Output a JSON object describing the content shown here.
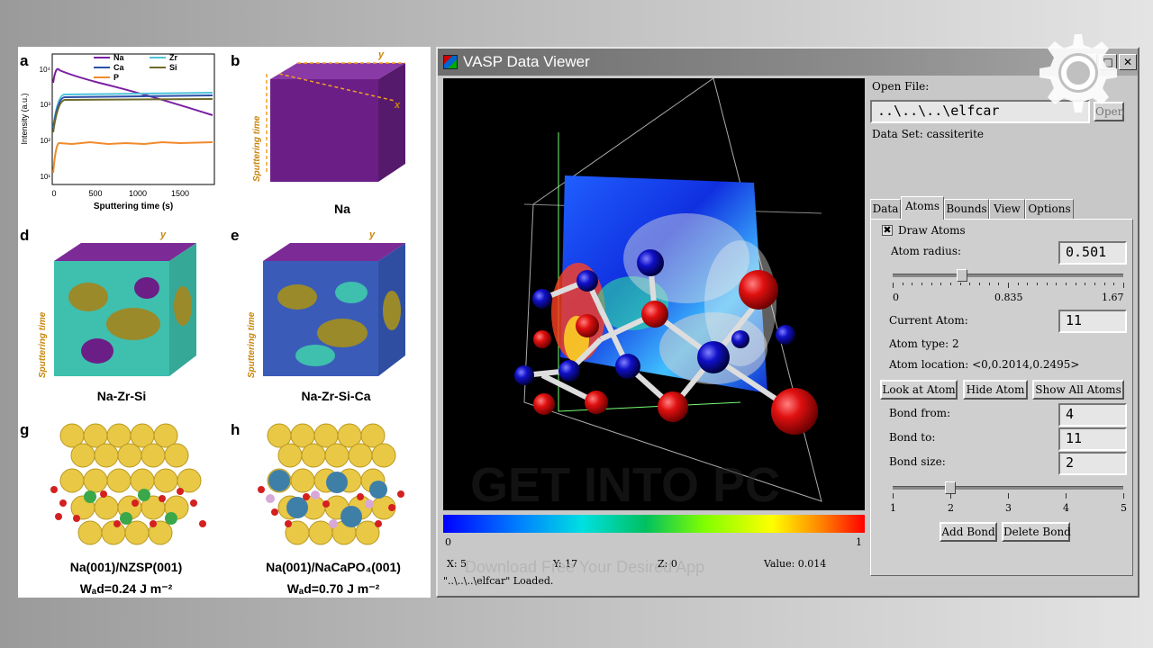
{
  "figure": {
    "panel_labels": [
      "a",
      "b",
      "d",
      "e",
      "g",
      "h"
    ],
    "chart_a": {
      "legend": [
        "Na",
        "Zr",
        "Ca",
        "Si",
        "P"
      ],
      "ylabel": "Intensity (a.u.)",
      "xlabel": "Sputtering time (s)",
      "yticks": [
        "10⁴",
        "10³",
        "10²",
        "10¹"
      ],
      "xticks": [
        "0",
        "500",
        "1000",
        "1500"
      ],
      "colors": {
        "Na": "#7a1fa2",
        "Zr": "#4fc3d9",
        "Ca": "#2c4fa8",
        "Si": "#6e6a2a",
        "P": "#f08a2c"
      }
    },
    "axis_y": "y",
    "axis_x": "x",
    "sputtering_time": "Sputtering time",
    "cap_b": "Na",
    "cap_d": "Na-Zr-Si",
    "cap_e": "Na-Zr-Si-Ca",
    "cap_g": "Na(001)/NZSP(001)",
    "cap_h": "Na(001)/NaCaPO₄(001)",
    "wad_g": "Wₐd=0.24 J m⁻²",
    "wad_h": "Wₐd=0.70 J m⁻²"
  },
  "window": {
    "title": "VASP Data Viewer",
    "controls": [
      "_",
      "□",
      "✕"
    ]
  },
  "colorbar": {
    "min": "0",
    "max": "1"
  },
  "readout": {
    "x": "X: 5",
    "y": "Y: 17",
    "z": "Z: 0",
    "value": "Value: 0.014"
  },
  "status": "\"..\\..\\..\\elfcar\" Loaded.",
  "watermark": {
    "main": "GET INTO PC",
    "sub": "Download Free Your Desired App"
  },
  "panel": {
    "open_file_label": "Open File:",
    "open_file_value": "..\\..\\..\\elfcar",
    "open_button": "Open",
    "dataset": "Data Set: cassiterite",
    "tabs": [
      "Data",
      "Atoms",
      "Bounds",
      "View",
      "Options"
    ],
    "active_tab": "Atoms",
    "draw_atoms_label": "Draw Atoms",
    "draw_atoms_checked": true,
    "atom_radius_label": "Atom radius:",
    "atom_radius_value": "0.501",
    "radius_slider": {
      "min": "0",
      "mid": "0.835",
      "max": "1.67",
      "value": 0.501,
      "range": [
        0,
        1.67
      ]
    },
    "current_atom_label": "Current Atom:",
    "current_atom_value": "11",
    "atom_type": "Atom type: 2",
    "atom_location": "Atom location: <0,0.2014,0.2495>",
    "look_button": "Look at Atom",
    "hide_button": "Hide Atom",
    "show_all_button": "Show All Atoms",
    "bond_from_label": "Bond from:",
    "bond_from_value": "4",
    "bond_to_label": "Bond to:",
    "bond_to_value": "11",
    "bond_size_label": "Bond size:",
    "bond_size_value": "2",
    "bond_slider": {
      "ticks": [
        "1",
        "2",
        "3",
        "4",
        "5"
      ],
      "value": 2,
      "range": [
        1,
        5
      ]
    },
    "add_bond_button": "Add Bond",
    "delete_bond_button": "Delete Bond"
  }
}
